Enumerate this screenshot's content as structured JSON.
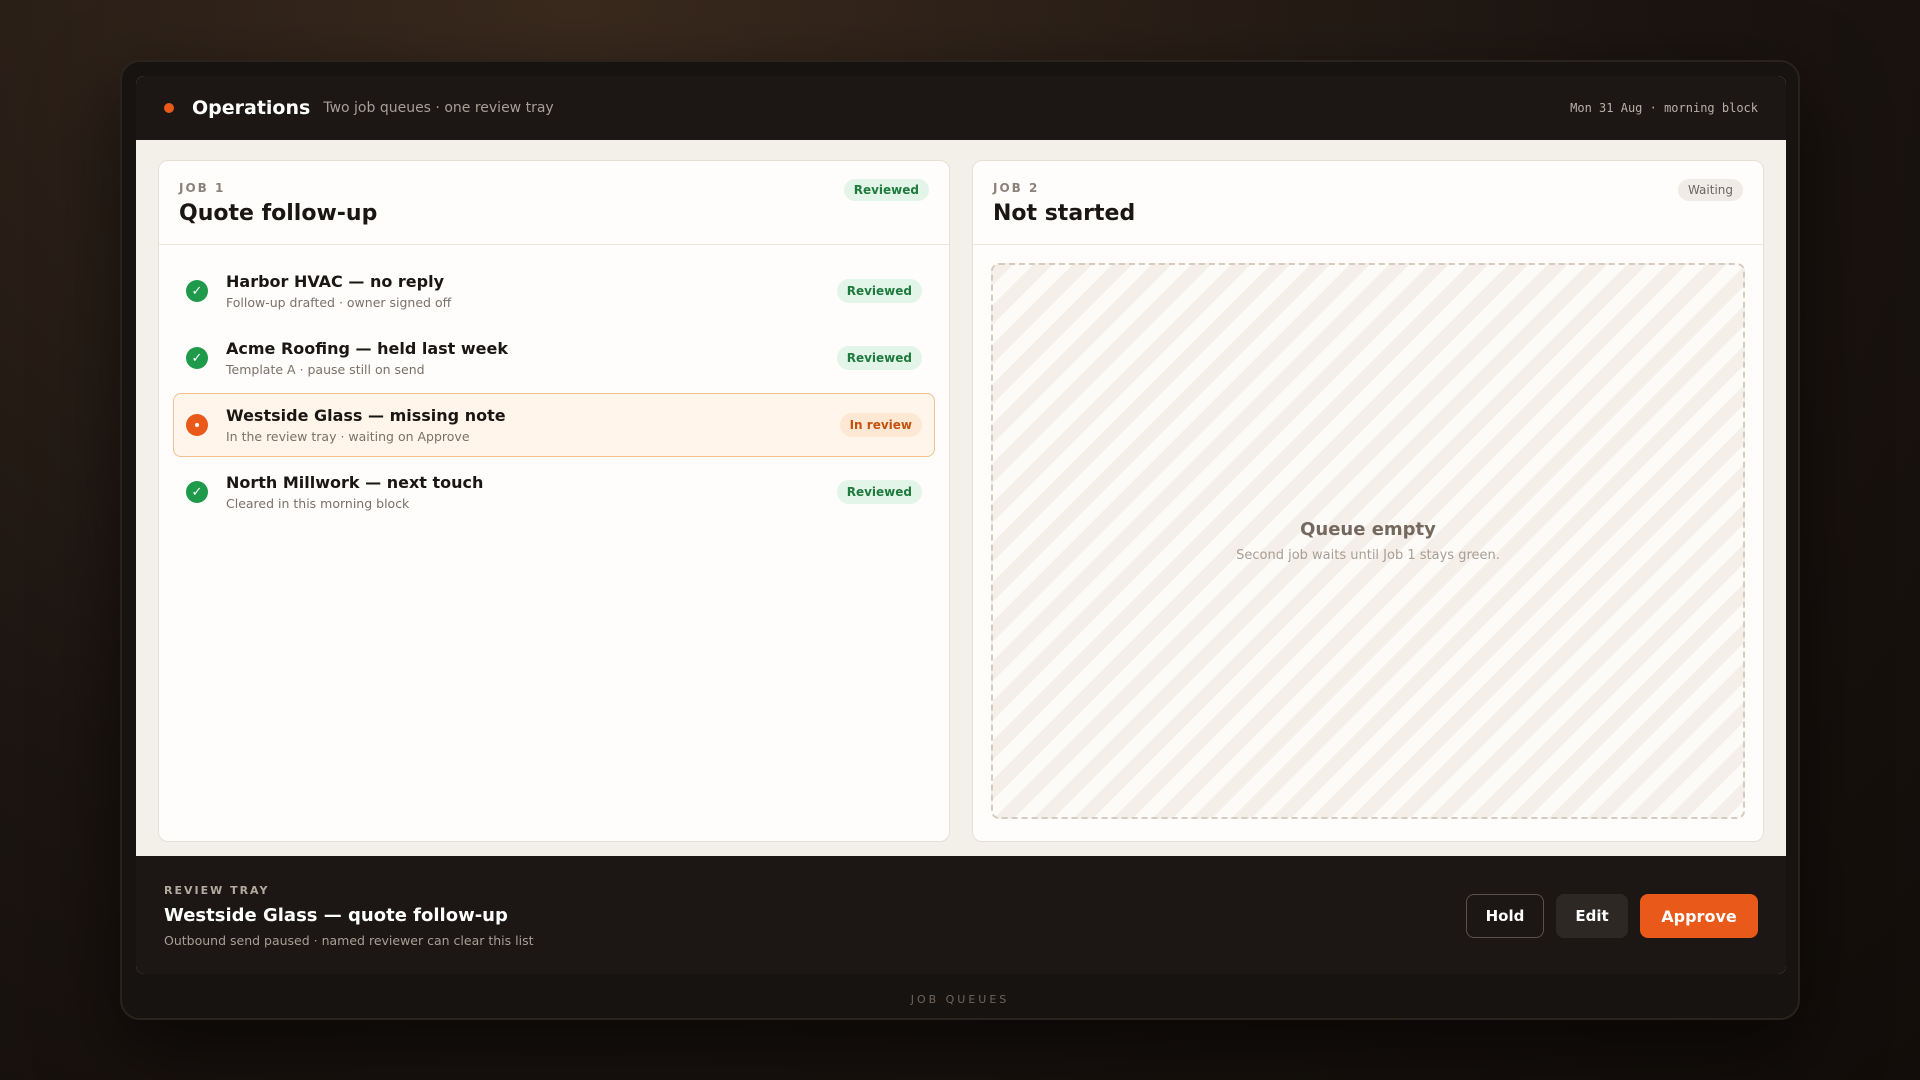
{
  "header": {
    "title": "Operations",
    "subtitle": "Two job queues · one review tray",
    "date": "Mon 31 Aug · morning block"
  },
  "job1": {
    "tag": "JOB 1",
    "title": "Quote follow-up",
    "badge": "Reviewed",
    "items": [
      {
        "title": "Harbor HVAC — no reply",
        "subtitle": "Follow-up drafted · owner signed off",
        "badge": "Reviewed",
        "state": "done"
      },
      {
        "title": "Acme Roofing — held last week",
        "subtitle": "Template A · pause still on send",
        "badge": "Reviewed",
        "state": "done"
      },
      {
        "title": "Westside Glass — missing note",
        "subtitle": "In the review tray · waiting on Approve",
        "badge": "In review",
        "state": "active"
      },
      {
        "title": "North Millwork — next touch",
        "subtitle": "Cleared in this morning block",
        "badge": "Reviewed",
        "state": "done"
      }
    ]
  },
  "job2": {
    "tag": "JOB 2",
    "title": "Not started",
    "badge": "Waiting",
    "empty_title": "Queue empty",
    "empty_subtitle": "Second job waits until Job 1 stays green."
  },
  "tray": {
    "tag": "REVIEW TRAY",
    "title": "Westside Glass — quote follow-up",
    "subtitle": "Outbound send paused · named reviewer can clear this list",
    "hold_label": "Hold",
    "edit_label": "Edit",
    "approve_label": "Approve"
  },
  "device_label": "JOB QUEUES",
  "colors": {
    "accent": "#e8591a",
    "success": "#1f9a4a"
  }
}
